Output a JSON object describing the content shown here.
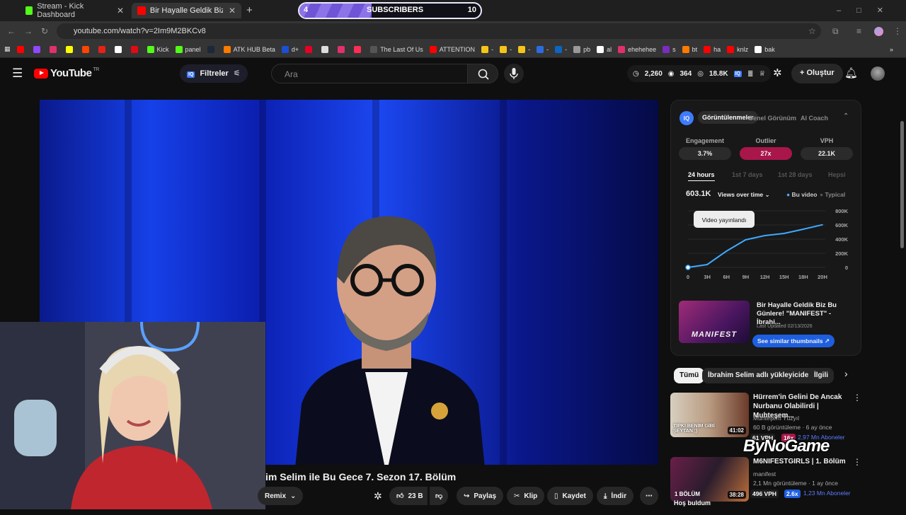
{
  "browser": {
    "tabs": [
      {
        "label": "Stream - Kick Dashboard",
        "active": false,
        "icon_color": "#53fc18"
      },
      {
        "label": "Bir Hayalle Geldik Biz Bu Günler",
        "active": true,
        "icon_color": "#ff0000"
      }
    ],
    "new_tab": "+",
    "url": "youtube.com/watch?v=2Im9M2BKCv8",
    "bookmarks": [
      {
        "label": "",
        "color": "#ff0000"
      },
      {
        "label": "",
        "color": "#9146ff"
      },
      {
        "label": "",
        "color": "#e1306c"
      },
      {
        "label": "",
        "color": "#fffc00"
      },
      {
        "label": "",
        "color": "#ff4500"
      },
      {
        "label": "",
        "color": "#e62117"
      },
      {
        "label": "",
        "color": "#ffffff"
      },
      {
        "label": "",
        "color": "#e50914"
      },
      {
        "label": "Kick",
        "color": "#53fc18"
      },
      {
        "label": "panel",
        "color": "#53fc18"
      },
      {
        "label": "",
        "color": "#1b2838"
      },
      {
        "label": "ATK HUB Beta",
        "color": "#ff7a00"
      },
      {
        "label": "d+",
        "color": "#1a4fd6"
      },
      {
        "label": "",
        "color": "#e60023"
      },
      {
        "label": "",
        "color": "#dddddd"
      },
      {
        "label": "",
        "color": "#e1306c"
      },
      {
        "label": "",
        "color": "#ff2d55"
      },
      {
        "label": "The Last Of Us",
        "color": "#555555"
      },
      {
        "label": "ATTENTION",
        "color": "#ff0000"
      },
      {
        "label": "-",
        "color": "#f5c518"
      },
      {
        "label": "-",
        "color": "#f5c518"
      },
      {
        "label": "-",
        "color": "#f5c518"
      },
      {
        "label": "-",
        "color": "#2d6cdf"
      },
      {
        "label": "-",
        "color": "#0a66c2"
      },
      {
        "label": "pb",
        "color": "#999999"
      },
      {
        "label": "al",
        "color": "#ffffff"
      },
      {
        "label": "ehehehee",
        "color": "#e1306c"
      },
      {
        "label": "s",
        "color": "#7b2cbf"
      },
      {
        "label": "bt",
        "color": "#ff7a00"
      },
      {
        "label": "ha",
        "color": "#ff0000"
      },
      {
        "label": "knlz",
        "color": "#ff0000"
      },
      {
        "label": "bak",
        "color": "#ffffff"
      }
    ],
    "overflow": "»"
  },
  "subscriber_widget": {
    "start": "4",
    "label": "SUBSCRIBERS",
    "goal": "10",
    "progress": 0.4
  },
  "youtube": {
    "logo_text": "YouTube",
    "region": "TR",
    "filters_label": "Filtreler",
    "search_placeholder": "Ara",
    "stats": {
      "a": "2,260",
      "b": "364",
      "c": "18.8K"
    },
    "create_label": "Oluştur"
  },
  "video": {
    "title": "im Selim ile Bu Gece 7. Sezon 17. Bölüm",
    "actions": {
      "remix": "Remix",
      "likes": "23 B",
      "share": "Paylaş",
      "clip": "Klip",
      "save": "Kaydet",
      "download": "İndir"
    }
  },
  "panel": {
    "badge": "IQ",
    "tabs": [
      "Görüntülenmeler",
      "Genel Görünüm",
      "AI Coach"
    ],
    "metrics": [
      {
        "label": "Engagement",
        "value": "3.7%"
      },
      {
        "label": "Outlier",
        "value": "27x"
      },
      {
        "label": "VPH",
        "value": "22.1K"
      }
    ],
    "ranges": [
      "24 hours",
      "1st 7 days",
      "1st 28 days",
      "Hepsi"
    ],
    "views": "603.1K",
    "views_dropdown": "Views over time",
    "legend": [
      "Bu video",
      "Typical"
    ],
    "tooltip": "Video yayınlandı",
    "chart_data": {
      "type": "line",
      "x": [
        "0",
        "3H",
        "6H",
        "9H",
        "12H",
        "15H",
        "18H",
        "20H"
      ],
      "series": [
        {
          "name": "Bu video",
          "values": [
            0,
            40000,
            230000,
            390000,
            450000,
            480000,
            540000,
            603100
          ]
        }
      ],
      "ylim": [
        0,
        800000
      ],
      "yticks": [
        "0",
        "200K",
        "400K",
        "600K",
        "800K"
      ]
    },
    "video_card": {
      "title": "Bir Hayalle Geldik Biz Bu Günlere! \"MANIFEST\" - İbrahi...",
      "updated": "Last Updated 02/13/2026",
      "thumb_text": "MANIFEST",
      "button": "See similar thumbnails ↗"
    }
  },
  "related": {
    "chips": [
      "Tümü",
      "İbrahim Selim adlı yükleyiciden",
      "İlgili"
    ],
    "items": [
      {
        "title": "Hürrem'in Gelini De Ancak Nurbanu Olabilirdi | Muhteşem...",
        "channel": "Muhteşem Yüzyıl",
        "meta": "60 B görüntüleme · 6 ay önce",
        "vph": "61 VPH",
        "outlier": "16x",
        "subs": "2,97 Mn Aboneler",
        "duration": "41:02",
        "thumb_caption": "TIPKI BENİM GİBİ ŞEYTAN ;)"
      },
      {
        "title": "M6NIFESTGIRLS | 1. Bölüm",
        "channel": "manifest",
        "meta": "2,1 Mn görüntüleme · 1 ay önce",
        "vph": "496 VPH",
        "outlier": "2.6x",
        "subs": "1,23 Mn Aboneler",
        "duration": "38:28",
        "thumb_caption": "1 BÖLÜM"
      }
    ]
  },
  "overlay": {
    "watermark": "ByNoGame",
    "chat": "Hoş buldum"
  }
}
